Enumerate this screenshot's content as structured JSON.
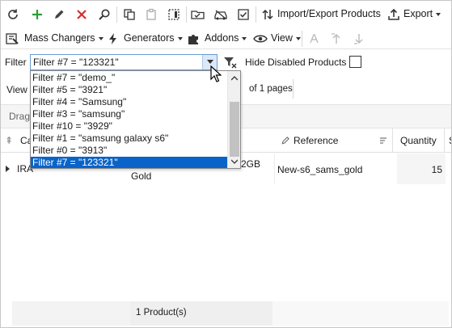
{
  "toolbar": {
    "import_export_label": "Import/Export Products",
    "export_label": "Export"
  },
  "toolbar2": {
    "mass_changers_label": "Mass Changers",
    "generators_label": "Generators",
    "addons_label": "Addons",
    "view_label": "View"
  },
  "filter": {
    "label": "Filter",
    "selected_value": "Filter #7 = \"123321\"",
    "hide_disabled_label": "Hide Disabled Products",
    "hide_disabled_checked": false,
    "options": [
      "Filter #7 = \"demo_\"",
      "Filter #5 = \"3921\"",
      "Filter #4 = \"Samsung\"",
      "Filter #3 = \"samsung\"",
      "Filter #10 = \"3929\"",
      "Filter #1 = \"samsung galaxy s6\"",
      "Filter #0 = \"3913\"",
      "Filter #7 = \"123321\""
    ],
    "selected_index": 7
  },
  "view_row": {
    "view_label": "View",
    "pages_text": "of 1 pages"
  },
  "drag_row": {
    "text": "Drag"
  },
  "grid": {
    "columns": {
      "category": "Ca",
      "reference": "Reference",
      "quantity": "Quantity",
      "extra": "S"
    },
    "row": {
      "name_part": "IRA",
      "name_gold": "Gold",
      "spec_part": "2GB",
      "reference": "New-s6_sams_gold",
      "quantity": "15"
    }
  },
  "footer": {
    "count_text": "1 Product(s)"
  },
  "colors": {
    "accent_blue": "#0a63c9",
    "add_green": "#2e9d3a",
    "delete_red": "#d32f2f"
  }
}
